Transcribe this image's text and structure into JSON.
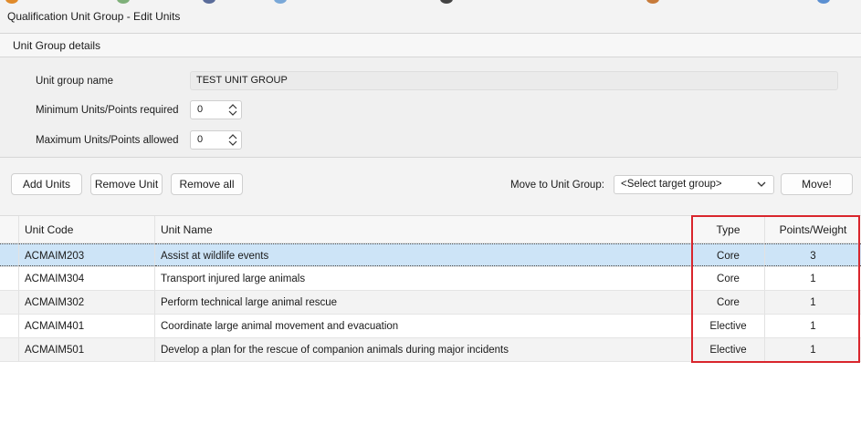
{
  "window": {
    "title": "Qualification Unit Group - Edit Units"
  },
  "details": {
    "header": "Unit Group details",
    "name_label": "Unit group name",
    "name_value": "TEST UNIT GROUP",
    "min_label": "Minimum Units/Points required",
    "min_value": "0",
    "max_label": "Maximum Units/Points allowed",
    "max_value": "0"
  },
  "toolbar": {
    "add_units": "Add Units",
    "remove_unit": "Remove Unit",
    "remove_all": "Remove all",
    "move_label": "Move to Unit Group:",
    "move_select": "<Select target group>",
    "move_button": "Move!"
  },
  "grid": {
    "columns": {
      "code": "Unit Code",
      "name": "Unit Name",
      "type": "Type",
      "points": "Points/Weight"
    },
    "rows": [
      {
        "code": "ACMAIM203",
        "name": "Assist at wildlife events",
        "type": "Core",
        "points": "3"
      },
      {
        "code": "ACMAIM304",
        "name": "Transport injured large animals",
        "type": "Core",
        "points": "1"
      },
      {
        "code": "ACMAIM302",
        "name": "Perform technical large animal rescue",
        "type": "Core",
        "points": "1"
      },
      {
        "code": "ACMAIM401",
        "name": "Coordinate large animal movement and evacuation",
        "type": "Elective",
        "points": "1"
      },
      {
        "code": "ACMAIM501",
        "name": "Develop a plan for the rescue of companion animals during major incidents",
        "type": "Elective",
        "points": "1"
      }
    ],
    "selected_row": 0
  },
  "colors": {
    "selection": "#cde4f7",
    "highlight": "#d9252c"
  }
}
